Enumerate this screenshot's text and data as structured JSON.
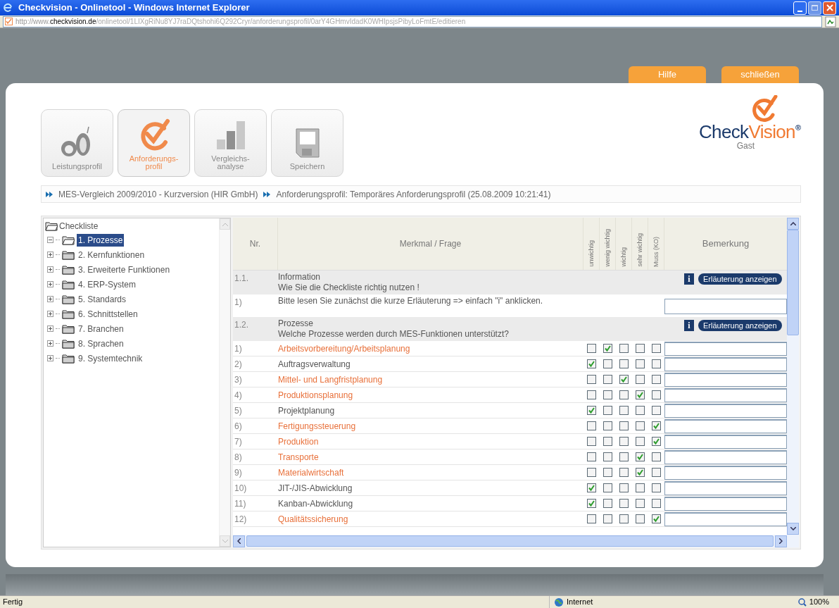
{
  "window": {
    "title": "Checkvision - Onlinetool - Windows Internet Explorer"
  },
  "address": {
    "prefix": "http://www.",
    "domain": "checkvision.de",
    "path": "/onlinetool/1LIXgRiNu8YJ7raDQtshohi6Q292Cryr/anforderungsprofil/0arY4GHmvIdadK0WHIpsjsPibyLoFmtE/editieren"
  },
  "top_buttons": [
    "Hilfe",
    "schließen"
  ],
  "toolbar": [
    {
      "kind": "fruit",
      "label": "Leistungsprofil",
      "selected": false
    },
    {
      "kind": "check",
      "label": "Anforderungs-profil",
      "selected": true
    },
    {
      "kind": "bars",
      "label": "Vergleichs-analyse",
      "selected": false
    },
    {
      "kind": "disk",
      "label": "Speichern",
      "selected": false
    }
  ],
  "logo": {
    "first": "Check",
    "second": "Vision",
    "mark": "®",
    "user": "Gast"
  },
  "breadcrumb": [
    "MES-Vergleich 2009/2010 - Kurzversion (HIR GmbH)",
    "Anforderungsprofil: Temporäres Anforderungsprofil (25.08.2009 10:21:41)"
  ],
  "tree": {
    "label": "Checkliste",
    "children": [
      {
        "label": "1. Prozesse",
        "expanded": true,
        "selected": true
      },
      {
        "label": "2. Kernfunktionen",
        "expanded": false,
        "selected": false
      },
      {
        "label": "3. Erweiterte Funktionen",
        "expanded": false,
        "selected": false
      },
      {
        "label": "4. ERP-System",
        "expanded": false,
        "selected": false
      },
      {
        "label": "5. Standards",
        "expanded": false,
        "selected": false
      },
      {
        "label": "6. Schnittstellen",
        "expanded": false,
        "selected": false
      },
      {
        "label": "7. Branchen",
        "expanded": false,
        "selected": false
      },
      {
        "label": "8. Sprachen",
        "expanded": false,
        "selected": false
      },
      {
        "label": "9. Systemtechnik",
        "expanded": false,
        "selected": false
      }
    ]
  },
  "table": {
    "columns": [
      "Nr.",
      "Merkmal / Frage",
      "unwichtig",
      "wenig wichtig",
      "wichtig",
      "sehr wichtig",
      "Muss (KO)",
      "Bemerkung"
    ],
    "rows": [
      {
        "kind": "section",
        "nr": "1.1.",
        "title": "Information",
        "subtitle": "Wie Sie die Checkliste richtig nutzen !",
        "info": "i",
        "button": "Erläuterung anzeigen"
      },
      {
        "kind": "note",
        "nr": "1)",
        "label": "Bitte lesen Sie zunächst die kurze Erläuterung => einfach \"i\" anklicken."
      },
      {
        "kind": "section",
        "nr": "1.2.",
        "title": "Prozesse",
        "subtitle": "Welche Prozesse werden durch MES-Funktionen unterstützt?",
        "info": "i",
        "button": "Erläuterung anzeigen"
      },
      {
        "kind": "item",
        "nr": "1)",
        "label": "Arbeitsvorbereitung/Arbeitsplanung",
        "highlighted": true,
        "checks": [
          {
            "checked": false
          },
          {
            "checked": true
          },
          {
            "checked": false
          },
          {
            "checked": false
          },
          {
            "checked": false
          }
        ]
      },
      {
        "kind": "item",
        "nr": "2)",
        "label": "Auftragsverwaltung",
        "highlighted": false,
        "checks": [
          {
            "checked": true
          },
          {
            "checked": false
          },
          {
            "checked": false
          },
          {
            "checked": false
          },
          {
            "checked": false
          }
        ]
      },
      {
        "kind": "item",
        "nr": "3)",
        "label": "Mittel- und Langfristplanung",
        "highlighted": true,
        "checks": [
          {
            "checked": false
          },
          {
            "checked": false
          },
          {
            "checked": true
          },
          {
            "checked": false
          },
          {
            "checked": false
          }
        ]
      },
      {
        "kind": "item",
        "nr": "4)",
        "label": "Produktionsplanung",
        "highlighted": true,
        "checks": [
          {
            "checked": false
          },
          {
            "checked": false
          },
          {
            "checked": false
          },
          {
            "checked": true
          },
          {
            "checked": false
          }
        ]
      },
      {
        "kind": "item",
        "nr": "5)",
        "label": "Projektplanung",
        "highlighted": false,
        "checks": [
          {
            "checked": true
          },
          {
            "checked": false
          },
          {
            "checked": false
          },
          {
            "checked": false
          },
          {
            "checked": false
          }
        ]
      },
      {
        "kind": "item",
        "nr": "6)",
        "label": "Fertigungssteuerung",
        "highlighted": true,
        "checks": [
          {
            "checked": false
          },
          {
            "checked": false
          },
          {
            "checked": false
          },
          {
            "checked": false
          },
          {
            "checked": true
          }
        ]
      },
      {
        "kind": "item",
        "nr": "7)",
        "label": "Produktion",
        "highlighted": true,
        "checks": [
          {
            "checked": false
          },
          {
            "checked": false
          },
          {
            "checked": false
          },
          {
            "checked": false
          },
          {
            "checked": true
          }
        ]
      },
      {
        "kind": "item",
        "nr": "8)",
        "label": "Transporte",
        "highlighted": true,
        "checks": [
          {
            "checked": false
          },
          {
            "checked": false
          },
          {
            "checked": false
          },
          {
            "checked": true
          },
          {
            "checked": false
          }
        ]
      },
      {
        "kind": "item",
        "nr": "9)",
        "label": "Materialwirtschaft",
        "highlighted": true,
        "checks": [
          {
            "checked": false
          },
          {
            "checked": false
          },
          {
            "checked": false
          },
          {
            "checked": true
          },
          {
            "checked": false
          }
        ]
      },
      {
        "kind": "item",
        "nr": "10)",
        "label": "JIT-/JIS-Abwicklung",
        "highlighted": false,
        "checks": [
          {
            "checked": true
          },
          {
            "checked": false
          },
          {
            "checked": false
          },
          {
            "checked": false
          },
          {
            "checked": false
          }
        ]
      },
      {
        "kind": "item",
        "nr": "11)",
        "label": "Kanban-Abwicklung",
        "highlighted": false,
        "checks": [
          {
            "checked": true
          },
          {
            "checked": false
          },
          {
            "checked": false
          },
          {
            "checked": false
          },
          {
            "checked": false
          }
        ]
      },
      {
        "kind": "item",
        "nr": "12)",
        "label": "Qualitätssicherung",
        "highlighted": true,
        "checks": [
          {
            "checked": false
          },
          {
            "checked": false
          },
          {
            "checked": false
          },
          {
            "checked": false
          },
          {
            "checked": true
          }
        ]
      }
    ]
  },
  "status_bar": {
    "text": "Fertig",
    "zone": "Internet",
    "zoom": "100%"
  }
}
